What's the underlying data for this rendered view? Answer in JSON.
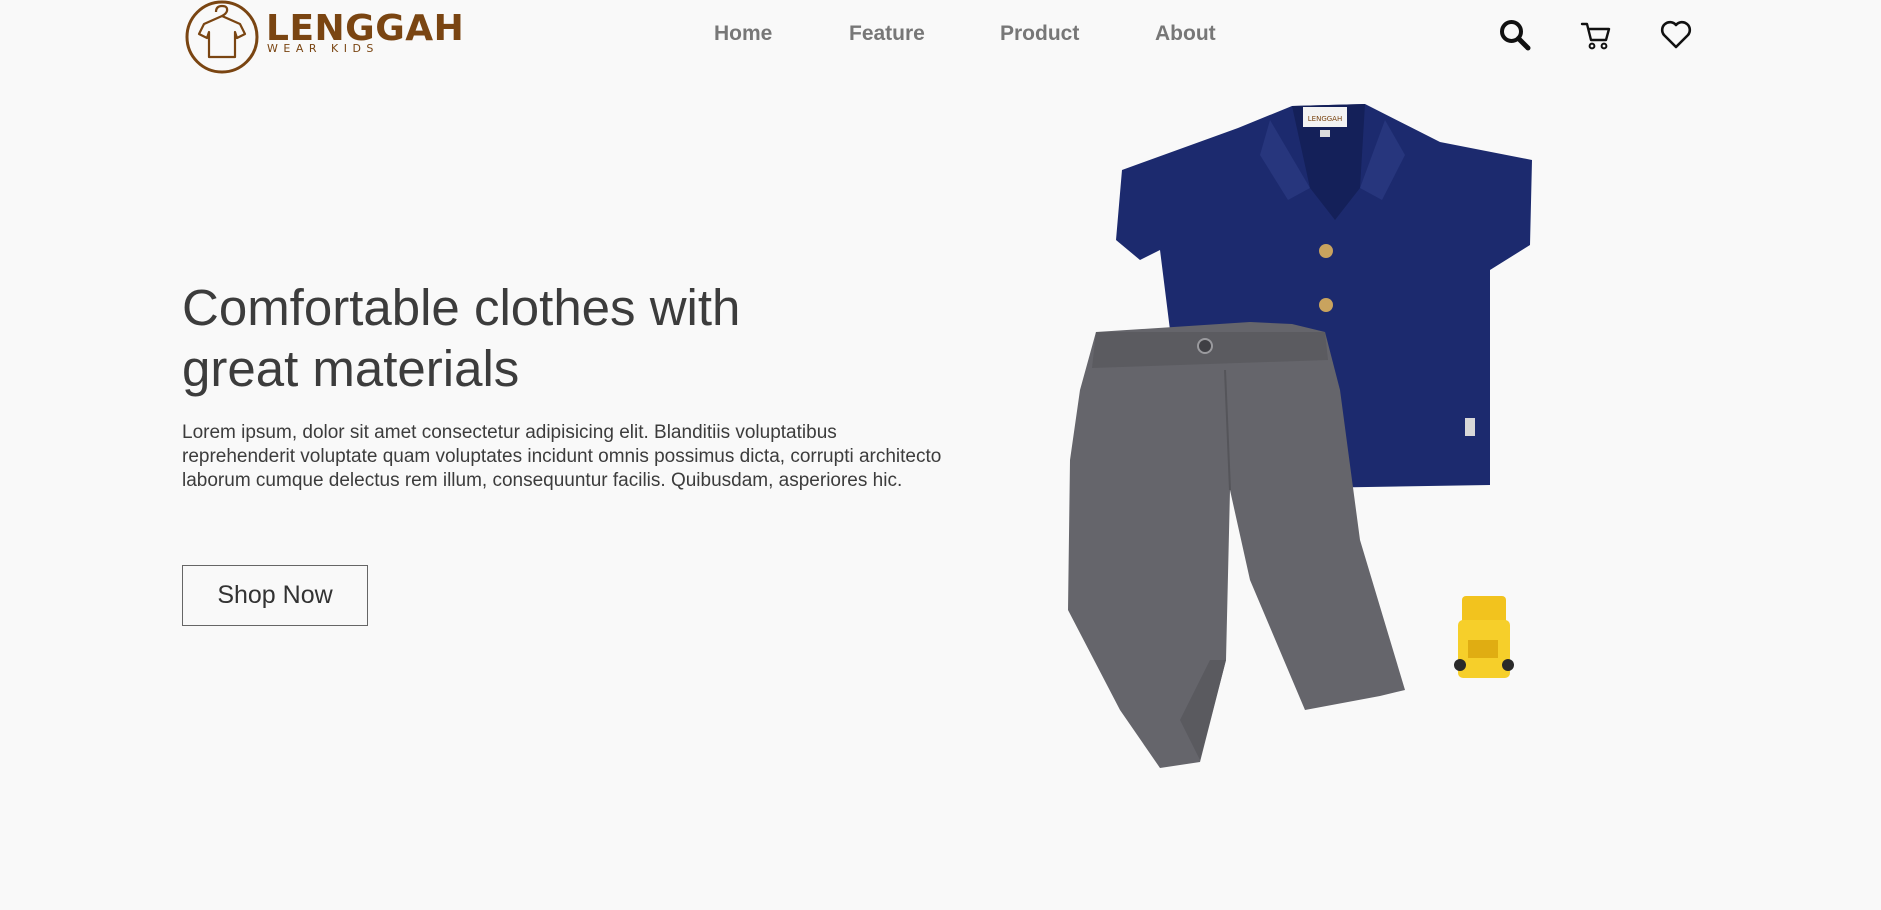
{
  "brand": {
    "name": "LENGGAH",
    "tagline": "WEAR KIDS",
    "color": "#7a4512"
  },
  "nav": {
    "items": [
      "Home",
      "Feature",
      "Product",
      "About"
    ]
  },
  "header_icons": [
    "search-icon",
    "cart-icon",
    "heart-icon"
  ],
  "hero": {
    "title_line1": "Comfortable clothes with",
    "title_line2": "great materials",
    "paragraph": "Lorem ipsum, dolor sit amet consectetur adipisicing elit. Blanditiis voluptatibus reprehenderit voluptate quam voluptates incidunt omnis possimus dicta, corrupti architecto laborum cumque delectus rem illum, consequuntur facilis. Quibusdam, asperiores hic.",
    "cta_label": "Shop Now",
    "shirt_label_text": "LENGGAH"
  },
  "colors": {
    "background": "#f9f9f9",
    "text": "#3c3c3c",
    "nav": "#777777",
    "shirt": "#1c2a6e",
    "pants": "#65656b",
    "toy": "#f2c31e"
  }
}
